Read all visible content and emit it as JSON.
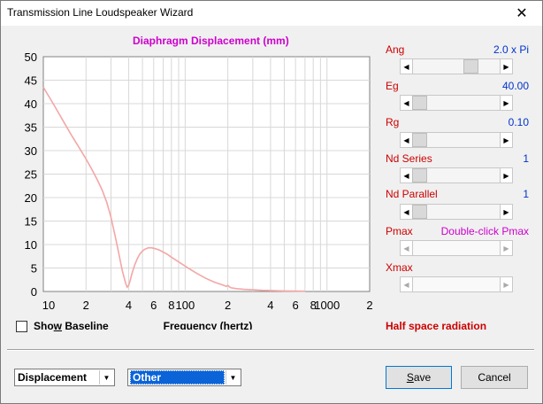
{
  "window": {
    "title": "Transmission Line Loudspeaker Wizard",
    "close_glyph": "✕"
  },
  "chart_data": {
    "type": "line",
    "title": "Diaphragm Displacement (mm)",
    "xlabel": "Frequency (hertz)",
    "ylabel": "",
    "x_scale": "log",
    "xlim": [
      10,
      2000
    ],
    "ylim": [
      0,
      50
    ],
    "y_ticks": [
      0,
      5,
      10,
      15,
      20,
      25,
      30,
      35,
      40,
      45,
      50
    ],
    "x_tick_labels": [
      {
        "value": 10,
        "label": "10"
      },
      {
        "value": 20,
        "label": "2"
      },
      {
        "value": 40,
        "label": "4"
      },
      {
        "value": 60,
        "label": "6"
      },
      {
        "value": 80,
        "label": "8"
      },
      {
        "value": 100,
        "label": "100"
      },
      {
        "value": 200,
        "label": "2"
      },
      {
        "value": 400,
        "label": "4"
      },
      {
        "value": 600,
        "label": "6"
      },
      {
        "value": 800,
        "label": "8"
      },
      {
        "value": 1000,
        "label": "1000"
      },
      {
        "value": 2000,
        "label": "2"
      }
    ],
    "grid": true,
    "line_color": "#f4a6a6",
    "series": [
      {
        "x": [
          10,
          12,
          14,
          16,
          18,
          20,
          22,
          24,
          26,
          28,
          30,
          32,
          34,
          36,
          38,
          39,
          40,
          41,
          42,
          44,
          46,
          48,
          50,
          52,
          55,
          58,
          62,
          66,
          70,
          75,
          80,
          90,
          100,
          110,
          120,
          140,
          160,
          180,
          195,
          200,
          205,
          210,
          230,
          260,
          300,
          350,
          400,
          500,
          600,
          700
        ],
        "y": [
          43.5,
          39.5,
          36.0,
          33.0,
          30.5,
          28.2,
          26.0,
          23.8,
          21.6,
          19.0,
          15.8,
          12.0,
          8.2,
          4.5,
          1.8,
          0.9,
          1.3,
          2.4,
          3.6,
          5.6,
          7.0,
          8.0,
          8.6,
          9.0,
          9.3,
          9.3,
          9.1,
          8.8,
          8.4,
          7.9,
          7.3,
          6.3,
          5.4,
          4.6,
          3.9,
          2.8,
          2.0,
          1.5,
          1.1,
          1.3,
          1.0,
          0.8,
          0.6,
          0.45,
          0.35,
          0.25,
          0.2,
          0.12,
          0.08,
          0.05
        ]
      }
    ]
  },
  "controls": {
    "ang": {
      "label": "Ang",
      "value": "2.0 x Pi",
      "level": 0.7
    },
    "eg": {
      "label": "Eg",
      "value": "40.00",
      "level": 0.0
    },
    "rg": {
      "label": "Rg",
      "value": "0.10",
      "level": 0.0
    },
    "nd_series": {
      "label": "Nd  Series",
      "value": "1",
      "level": 0.0
    },
    "nd_parallel": {
      "label": "Nd  Parallel",
      "value": "1",
      "level": 0.0
    },
    "pmax": {
      "label": "Pmax",
      "value": "Double-click Pmax"
    },
    "xmax": {
      "label": "Xmax"
    }
  },
  "show_baseline": {
    "label_pre": "Sho",
    "label_key": "w",
    "label_post": " Baseline",
    "checked": false
  },
  "status_text": "Half space radiation",
  "combo_left": {
    "value": "Displacement"
  },
  "combo_right": {
    "value": "Other"
  },
  "buttons": {
    "save_key": "S",
    "save_rest": "ave",
    "cancel": "Cancel"
  },
  "colors": {
    "red_label": "#cc0000",
    "blue_value": "#0033cc",
    "magenta": "#cc00cc",
    "selection": "#0a64d8"
  }
}
